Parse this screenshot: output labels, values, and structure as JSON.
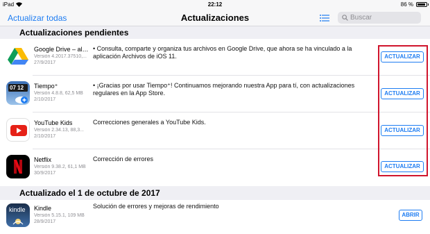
{
  "status_bar": {
    "device": "iPad",
    "time": "22:12",
    "battery": "86 %"
  },
  "nav": {
    "update_all": "Actualizar todas",
    "title": "Actualizaciones",
    "search_placeholder": "Buscar"
  },
  "sections": [
    {
      "title": "Actualizaciones pendientes"
    },
    {
      "title": "Actualizado el 1 de octubre de 2017"
    }
  ],
  "pending": [
    {
      "name": "Google Drive – alm...",
      "version": "Versión 4.2017.37510,...",
      "date": "27/9/2017",
      "description": "• Consulta, comparte y organiza tus archivos en Google Drive, que ahora se ha vinculado a la aplicación Archivos de iOS 11.",
      "action": "ACTUALIZAR",
      "icon": "google-drive-icon"
    },
    {
      "name": "Tiempo⁺",
      "version": "Versión 4.8.8, 62,5 MB",
      "date": "2/10/2017",
      "description": "• ¡Gracias por usar Tiempo⁺! Continuamos mejorando nuestra App para tí, con actualizaciones regulares en la App Store.",
      "action": "ACTUALIZAR",
      "icon": "weather-clock-icon",
      "icon_text": "07 12"
    },
    {
      "name": "YouTube Kids",
      "version": "Versión 2.34.13, 88,3...",
      "date": "2/10/2017",
      "description": "Correcciones generales a YouTube Kids.",
      "action": "ACTUALIZAR",
      "icon": "youtube-kids-icon"
    },
    {
      "name": "Netflix",
      "version": "Versión 9.38.2, 61,1 MB",
      "date": "30/9/2017",
      "description": "Corrección de errores",
      "action": "ACTUALIZAR",
      "icon": "netflix-icon"
    }
  ],
  "updated": [
    {
      "name": "Kindle",
      "version": "Versión 5.15.1, 109 MB",
      "date": "28/9/2017",
      "description": "Solución de errores y mejoras de rendimiento",
      "action": "ABRIR",
      "icon": "kindle-icon",
      "icon_text": "kindle"
    }
  ],
  "colors": {
    "accent": "#1d7cf2",
    "highlight": "#d0142c",
    "section_bg": "#efeff4"
  }
}
